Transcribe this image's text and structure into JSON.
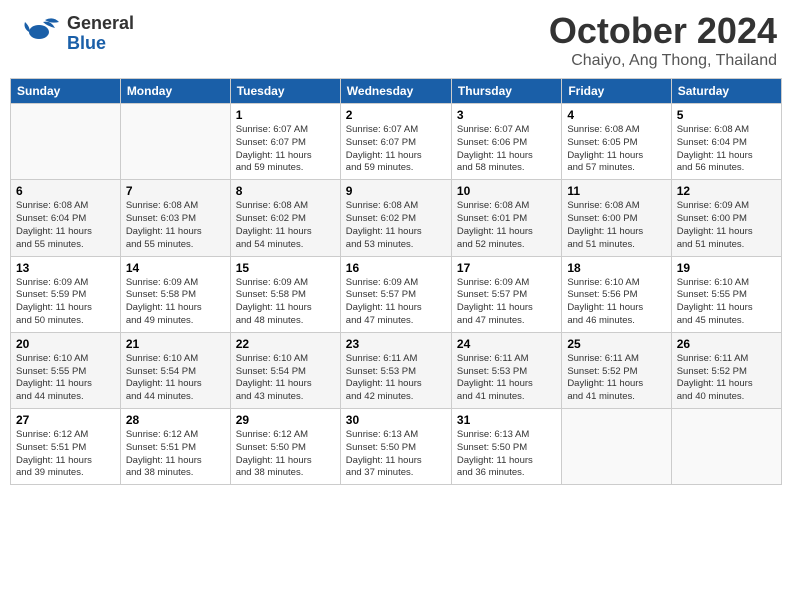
{
  "header": {
    "logo_line1": "General",
    "logo_line2": "Blue",
    "month": "October 2024",
    "location": "Chaiyo, Ang Thong, Thailand"
  },
  "weekdays": [
    "Sunday",
    "Monday",
    "Tuesday",
    "Wednesday",
    "Thursday",
    "Friday",
    "Saturday"
  ],
  "weeks": [
    [
      {
        "day": "",
        "info": ""
      },
      {
        "day": "",
        "info": ""
      },
      {
        "day": "1",
        "info": "Sunrise: 6:07 AM\nSunset: 6:07 PM\nDaylight: 11 hours\nand 59 minutes."
      },
      {
        "day": "2",
        "info": "Sunrise: 6:07 AM\nSunset: 6:07 PM\nDaylight: 11 hours\nand 59 minutes."
      },
      {
        "day": "3",
        "info": "Sunrise: 6:07 AM\nSunset: 6:06 PM\nDaylight: 11 hours\nand 58 minutes."
      },
      {
        "day": "4",
        "info": "Sunrise: 6:08 AM\nSunset: 6:05 PM\nDaylight: 11 hours\nand 57 minutes."
      },
      {
        "day": "5",
        "info": "Sunrise: 6:08 AM\nSunset: 6:04 PM\nDaylight: 11 hours\nand 56 minutes."
      }
    ],
    [
      {
        "day": "6",
        "info": "Sunrise: 6:08 AM\nSunset: 6:04 PM\nDaylight: 11 hours\nand 55 minutes."
      },
      {
        "day": "7",
        "info": "Sunrise: 6:08 AM\nSunset: 6:03 PM\nDaylight: 11 hours\nand 55 minutes."
      },
      {
        "day": "8",
        "info": "Sunrise: 6:08 AM\nSunset: 6:02 PM\nDaylight: 11 hours\nand 54 minutes."
      },
      {
        "day": "9",
        "info": "Sunrise: 6:08 AM\nSunset: 6:02 PM\nDaylight: 11 hours\nand 53 minutes."
      },
      {
        "day": "10",
        "info": "Sunrise: 6:08 AM\nSunset: 6:01 PM\nDaylight: 11 hours\nand 52 minutes."
      },
      {
        "day": "11",
        "info": "Sunrise: 6:08 AM\nSunset: 6:00 PM\nDaylight: 11 hours\nand 51 minutes."
      },
      {
        "day": "12",
        "info": "Sunrise: 6:09 AM\nSunset: 6:00 PM\nDaylight: 11 hours\nand 51 minutes."
      }
    ],
    [
      {
        "day": "13",
        "info": "Sunrise: 6:09 AM\nSunset: 5:59 PM\nDaylight: 11 hours\nand 50 minutes."
      },
      {
        "day": "14",
        "info": "Sunrise: 6:09 AM\nSunset: 5:58 PM\nDaylight: 11 hours\nand 49 minutes."
      },
      {
        "day": "15",
        "info": "Sunrise: 6:09 AM\nSunset: 5:58 PM\nDaylight: 11 hours\nand 48 minutes."
      },
      {
        "day": "16",
        "info": "Sunrise: 6:09 AM\nSunset: 5:57 PM\nDaylight: 11 hours\nand 47 minutes."
      },
      {
        "day": "17",
        "info": "Sunrise: 6:09 AM\nSunset: 5:57 PM\nDaylight: 11 hours\nand 47 minutes."
      },
      {
        "day": "18",
        "info": "Sunrise: 6:10 AM\nSunset: 5:56 PM\nDaylight: 11 hours\nand 46 minutes."
      },
      {
        "day": "19",
        "info": "Sunrise: 6:10 AM\nSunset: 5:55 PM\nDaylight: 11 hours\nand 45 minutes."
      }
    ],
    [
      {
        "day": "20",
        "info": "Sunrise: 6:10 AM\nSunset: 5:55 PM\nDaylight: 11 hours\nand 44 minutes."
      },
      {
        "day": "21",
        "info": "Sunrise: 6:10 AM\nSunset: 5:54 PM\nDaylight: 11 hours\nand 44 minutes."
      },
      {
        "day": "22",
        "info": "Sunrise: 6:10 AM\nSunset: 5:54 PM\nDaylight: 11 hours\nand 43 minutes."
      },
      {
        "day": "23",
        "info": "Sunrise: 6:11 AM\nSunset: 5:53 PM\nDaylight: 11 hours\nand 42 minutes."
      },
      {
        "day": "24",
        "info": "Sunrise: 6:11 AM\nSunset: 5:53 PM\nDaylight: 11 hours\nand 41 minutes."
      },
      {
        "day": "25",
        "info": "Sunrise: 6:11 AM\nSunset: 5:52 PM\nDaylight: 11 hours\nand 41 minutes."
      },
      {
        "day": "26",
        "info": "Sunrise: 6:11 AM\nSunset: 5:52 PM\nDaylight: 11 hours\nand 40 minutes."
      }
    ],
    [
      {
        "day": "27",
        "info": "Sunrise: 6:12 AM\nSunset: 5:51 PM\nDaylight: 11 hours\nand 39 minutes."
      },
      {
        "day": "28",
        "info": "Sunrise: 6:12 AM\nSunset: 5:51 PM\nDaylight: 11 hours\nand 38 minutes."
      },
      {
        "day": "29",
        "info": "Sunrise: 6:12 AM\nSunset: 5:50 PM\nDaylight: 11 hours\nand 38 minutes."
      },
      {
        "day": "30",
        "info": "Sunrise: 6:13 AM\nSunset: 5:50 PM\nDaylight: 11 hours\nand 37 minutes."
      },
      {
        "day": "31",
        "info": "Sunrise: 6:13 AM\nSunset: 5:50 PM\nDaylight: 11 hours\nand 36 minutes."
      },
      {
        "day": "",
        "info": ""
      },
      {
        "day": "",
        "info": ""
      }
    ]
  ]
}
